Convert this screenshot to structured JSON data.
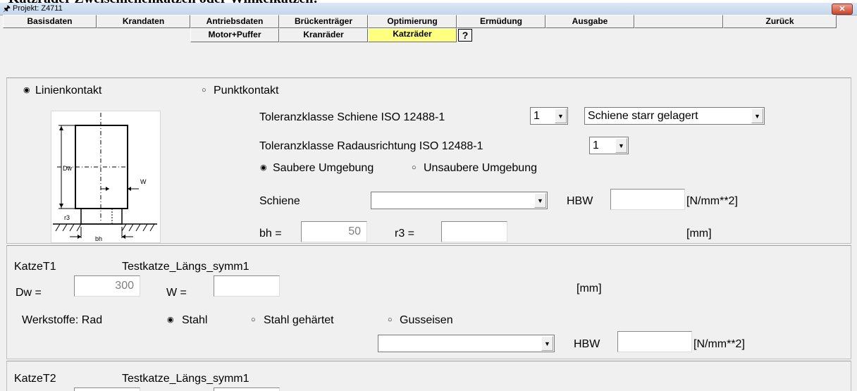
{
  "document": {
    "caption": "Katzräder Zweischienenkatzen oder Winkelkatzen:"
  },
  "window": {
    "title": "Projekt: Z4711",
    "close_glyph": "✕"
  },
  "tabs_row1": [
    {
      "label": "Basisdaten"
    },
    {
      "label": "Krandaten"
    },
    {
      "label": "Antriebsdaten"
    },
    {
      "label": "Brückenträger"
    },
    {
      "label": "Optimierung"
    },
    {
      "label": "Ermüdung"
    },
    {
      "label": "Ausgabe"
    },
    {
      "label": ""
    },
    {
      "label": "Zurück"
    }
  ],
  "tabs_row2": [
    {
      "label": "Motor+Puffer"
    },
    {
      "label": "Kranräder"
    },
    {
      "label": "Katzräder"
    }
  ],
  "help_button": {
    "label": "?"
  },
  "contact": {
    "linien_label": "Linienkontakt",
    "linien_selected": true,
    "punkt_label": "Punktkontakt",
    "punkt_selected": false
  },
  "toleranz_schiene": {
    "label": "Toleranzklasse Schiene ISO 12488-1",
    "value": "1",
    "lagerung_value": "Schiene starr gelagert"
  },
  "toleranz_rad": {
    "label": "Toleranzklasse Radausrichtung ISO 12488-1",
    "value": "1"
  },
  "umgebung": {
    "sauber_label": "Saubere Umgebung",
    "sauber_selected": true,
    "unsauber_label": "Unsaubere Umgebung",
    "unsauber_selected": false
  },
  "schiene": {
    "label": "Schiene",
    "value": "",
    "hbw_label": "HBW",
    "hbw_value": "",
    "hbw_unit": "[N/mm**2]"
  },
  "dims": {
    "bh_label": "bh =",
    "bh_value": "50",
    "r3_label": "r3 =",
    "r3_value": "",
    "unit": "[mm]"
  },
  "diagram": {
    "dw": "Dw",
    "w": "W",
    "r3": "r3",
    "bh": "bh"
  },
  "katze1": {
    "id": "KatzeT1",
    "name": "Testkatze_Längs_symm1",
    "dw_label": "Dw =",
    "dw_value": "300",
    "w_label": "W =",
    "w_value": "",
    "unit": "[mm]",
    "werkstoffe_label": "Werkstoffe:  Rad",
    "stahl_label": "Stahl",
    "stahl_selected": true,
    "stahl_gehaertet_label": "Stahl gehärtet",
    "stahl_gehaertet_selected": false,
    "guss_label": "Gusseisen",
    "guss_selected": false,
    "material_value": "",
    "hbw_label": "HBW",
    "hbw_value": "",
    "hbw_unit": "[N/mm**2]"
  },
  "katze2": {
    "id": "KatzeT2",
    "name": "Testkatze_Längs_symm1"
  },
  "colors": {
    "active_tab": "#ffff80",
    "window_bg": "#f0f0f0",
    "close": "#c7462c"
  }
}
